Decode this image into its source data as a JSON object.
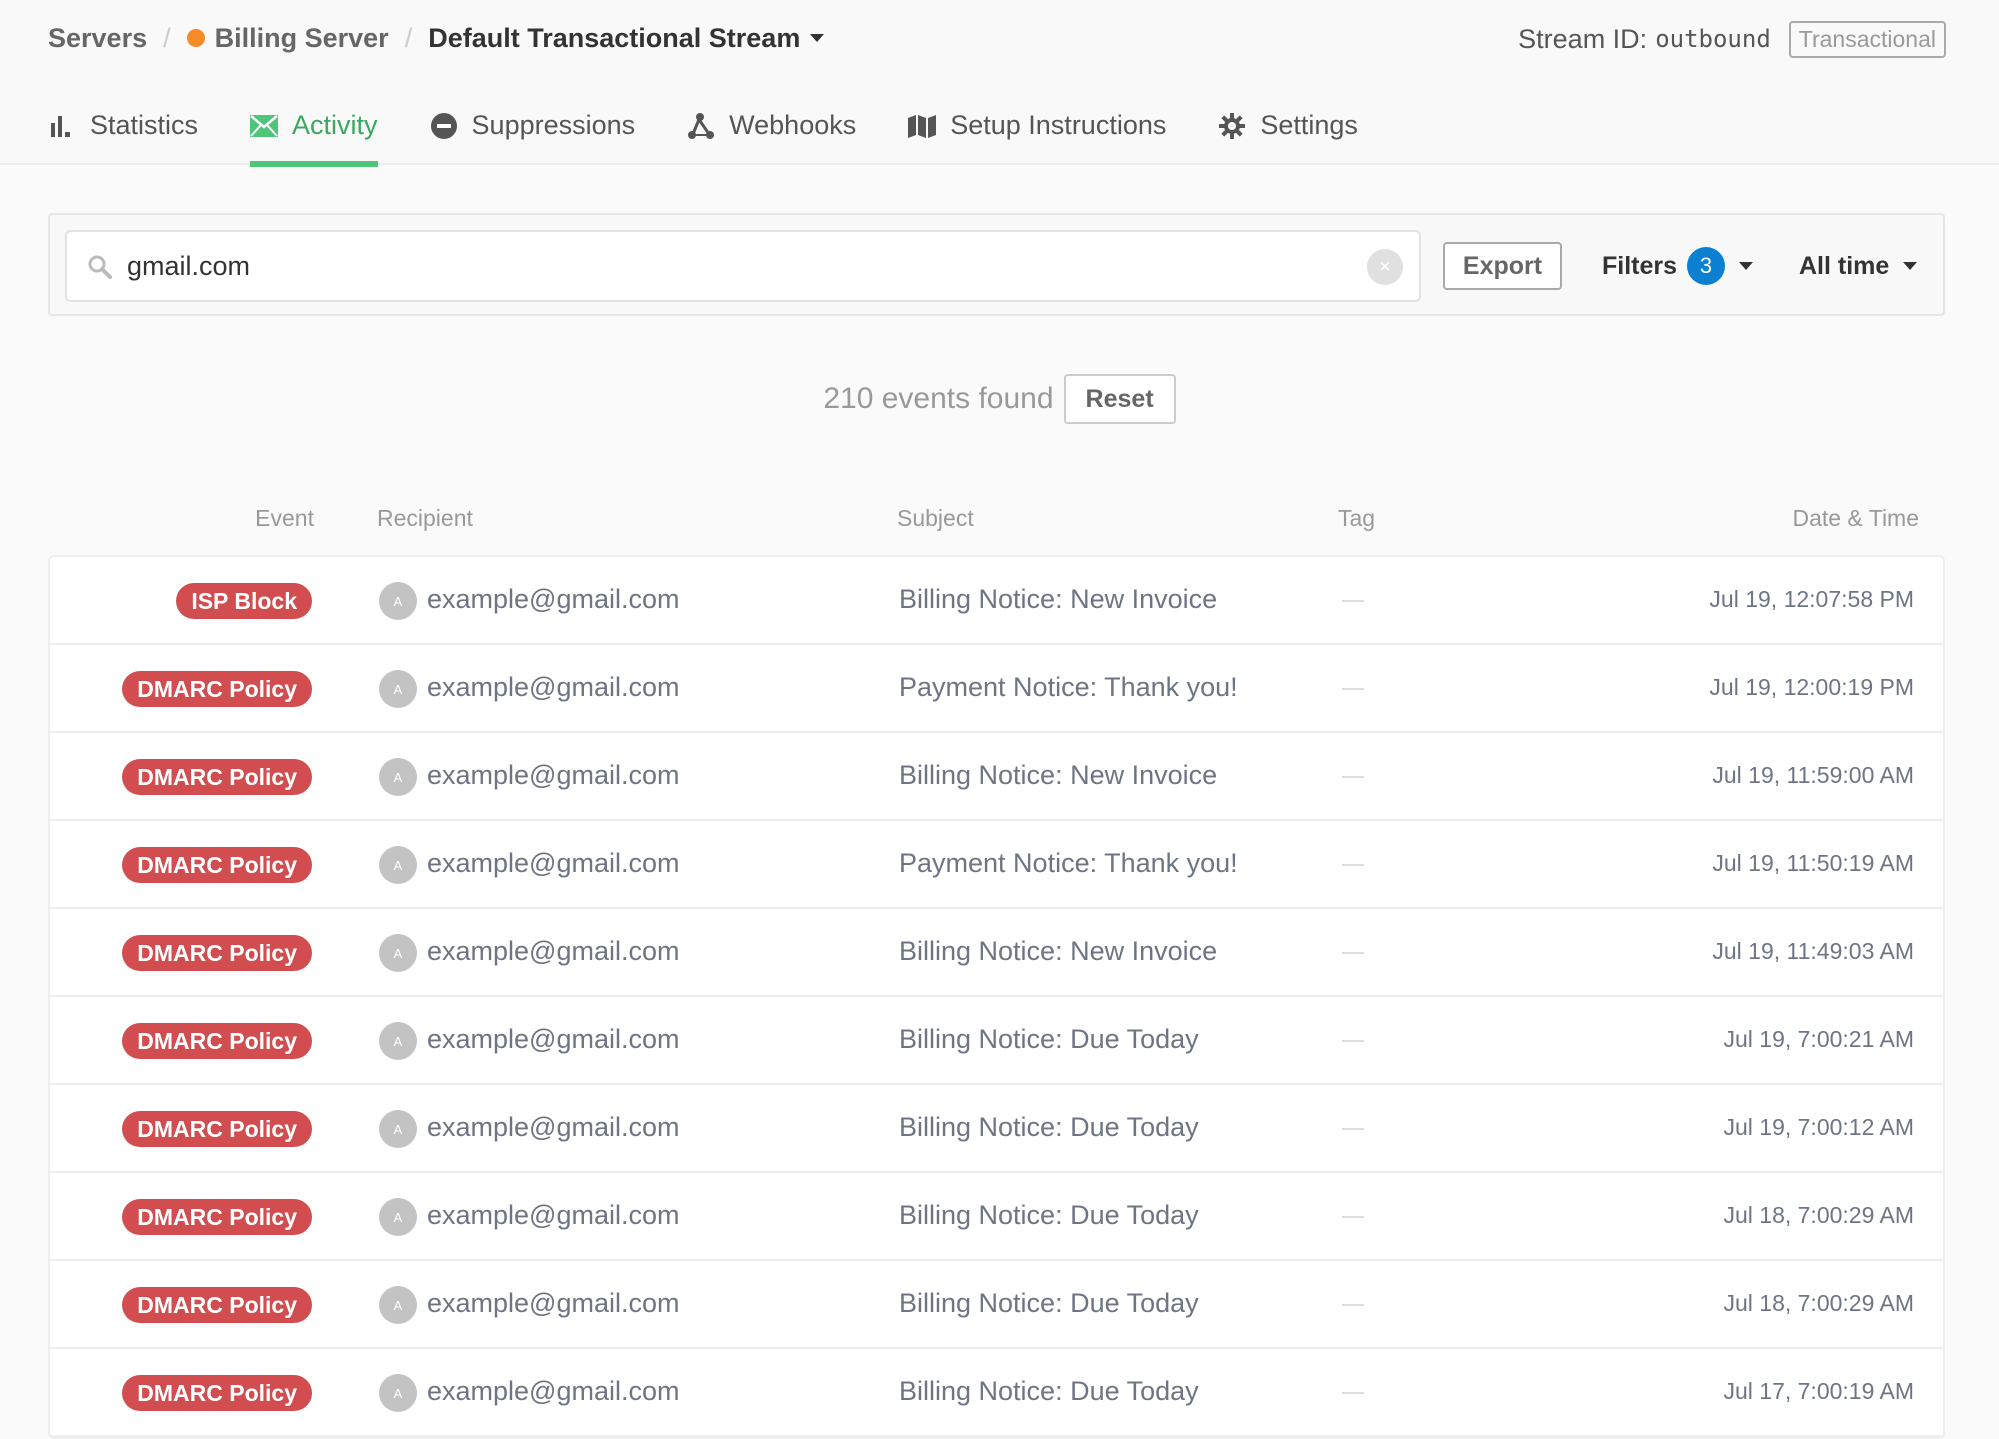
{
  "breadcrumb": {
    "servers": "Servers",
    "server": "Billing Server",
    "server_status_color": "#f58a28",
    "stream": "Default Transactional Stream"
  },
  "stream_info": {
    "label": "Stream ID:",
    "id": "outbound",
    "type": "Transactional"
  },
  "tabs": [
    {
      "label": "Statistics",
      "icon": "bar-chart-icon",
      "active": false
    },
    {
      "label": "Activity",
      "icon": "envelope-icon",
      "active": true
    },
    {
      "label": "Suppressions",
      "icon": "minus-circle-icon",
      "active": false
    },
    {
      "label": "Webhooks",
      "icon": "webhook-icon",
      "active": false
    },
    {
      "label": "Setup Instructions",
      "icon": "map-icon",
      "active": false
    },
    {
      "label": "Settings",
      "icon": "gear-icon",
      "active": false
    }
  ],
  "filters": {
    "search_value": "gmail.com",
    "export_label": "Export",
    "filters_label": "Filters",
    "filters_count": "3",
    "time_range": "All time"
  },
  "results": {
    "count_text": "210 events found",
    "reset_label": "Reset"
  },
  "table": {
    "headers": {
      "event": "Event",
      "recipient": "Recipient",
      "subject": "Subject",
      "tag": "Tag",
      "datetime": "Date & Time"
    },
    "rows": [
      {
        "event": "ISP Block",
        "avatar": "A",
        "recipient": "example@gmail.com",
        "subject": "Billing Notice: New Invoice",
        "tag": "—",
        "datetime": "Jul 19, 12:07:58 PM"
      },
      {
        "event": "DMARC Policy",
        "avatar": "A",
        "recipient": "example@gmail.com",
        "subject": "Payment Notice: Thank you!",
        "tag": "—",
        "datetime": "Jul 19, 12:00:19 PM"
      },
      {
        "event": "DMARC Policy",
        "avatar": "A",
        "recipient": "example@gmail.com",
        "subject": "Billing Notice: New Invoice",
        "tag": "—",
        "datetime": "Jul 19, 11:59:00 AM"
      },
      {
        "event": "DMARC Policy",
        "avatar": "A",
        "recipient": "example@gmail.com",
        "subject": "Payment Notice: Thank you!",
        "tag": "—",
        "datetime": "Jul 19, 11:50:19 AM"
      },
      {
        "event": "DMARC Policy",
        "avatar": "A",
        "recipient": "example@gmail.com",
        "subject": "Billing Notice: New Invoice",
        "tag": "—",
        "datetime": "Jul 19, 11:49:03 AM"
      },
      {
        "event": "DMARC Policy",
        "avatar": "A",
        "recipient": "example@gmail.com",
        "subject": "Billing Notice: Due Today",
        "tag": "—",
        "datetime": "Jul 19, 7:00:21 AM"
      },
      {
        "event": "DMARC Policy",
        "avatar": "A",
        "recipient": "example@gmail.com",
        "subject": "Billing Notice: Due Today",
        "tag": "—",
        "datetime": "Jul 19, 7:00:12 AM"
      },
      {
        "event": "DMARC Policy",
        "avatar": "A",
        "recipient": "example@gmail.com",
        "subject": "Billing Notice: Due Today",
        "tag": "—",
        "datetime": "Jul 18, 7:00:29 AM"
      },
      {
        "event": "DMARC Policy",
        "avatar": "A",
        "recipient": "example@gmail.com",
        "subject": "Billing Notice: Due Today",
        "tag": "—",
        "datetime": "Jul 18, 7:00:29 AM"
      },
      {
        "event": "DMARC Policy",
        "avatar": "A",
        "recipient": "example@gmail.com",
        "subject": "Billing Notice: Due Today",
        "tag": "—",
        "datetime": "Jul 17, 7:00:19 AM"
      }
    ]
  },
  "colors": {
    "accent_green": "#4fc57a",
    "active_tab_text": "#3aa860",
    "event_badge_red": "#d24d4f",
    "filter_count_blue": "#0b7fd0"
  }
}
